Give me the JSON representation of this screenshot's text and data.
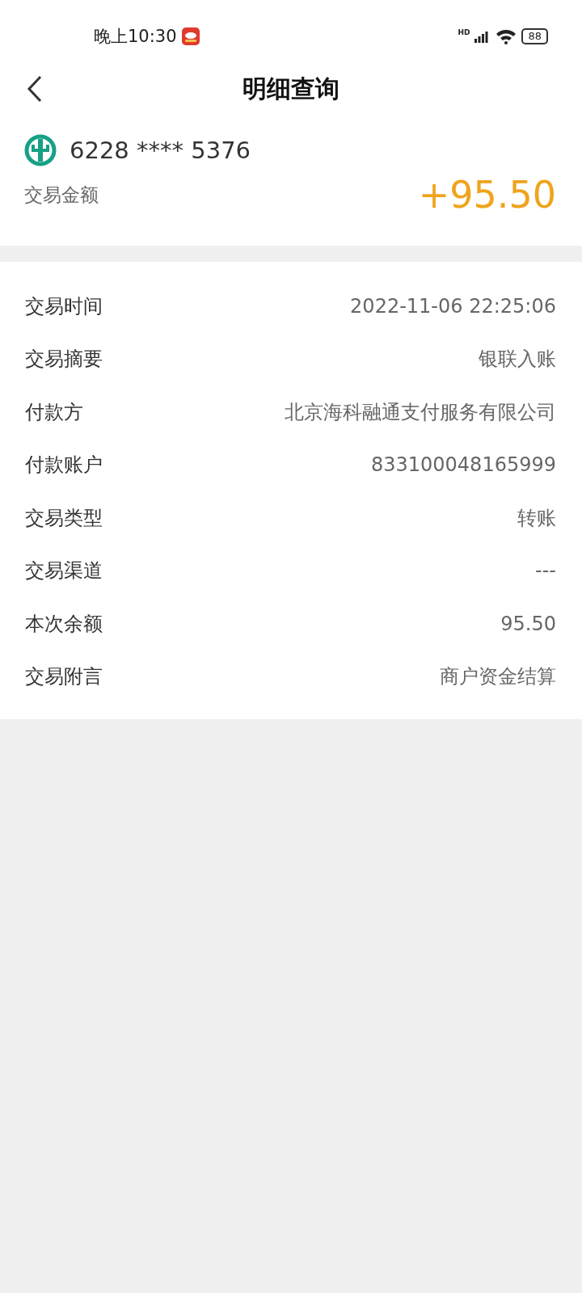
{
  "status_bar": {
    "time": "晚上10:30",
    "network_label": "HD",
    "battery": "88"
  },
  "header": {
    "title": "明细查询"
  },
  "account": {
    "card_number": "6228 **** 5376",
    "amount_label": "交易金额",
    "amount": "+95.50"
  },
  "details": [
    {
      "label": "交易时间",
      "value": "2022-11-06 22:25:06"
    },
    {
      "label": "交易摘要",
      "value": "银联入账"
    },
    {
      "label": "付款方",
      "value": "北京海科融通支付服务有限公司"
    },
    {
      "label": "付款账户",
      "value": "833100048165999"
    },
    {
      "label": "交易类型",
      "value": "转账"
    },
    {
      "label": "交易渠道",
      "value": "---"
    },
    {
      "label": "本次余额",
      "value": "95.50"
    },
    {
      "label": "交易附言",
      "value": "商户资金结算"
    }
  ]
}
